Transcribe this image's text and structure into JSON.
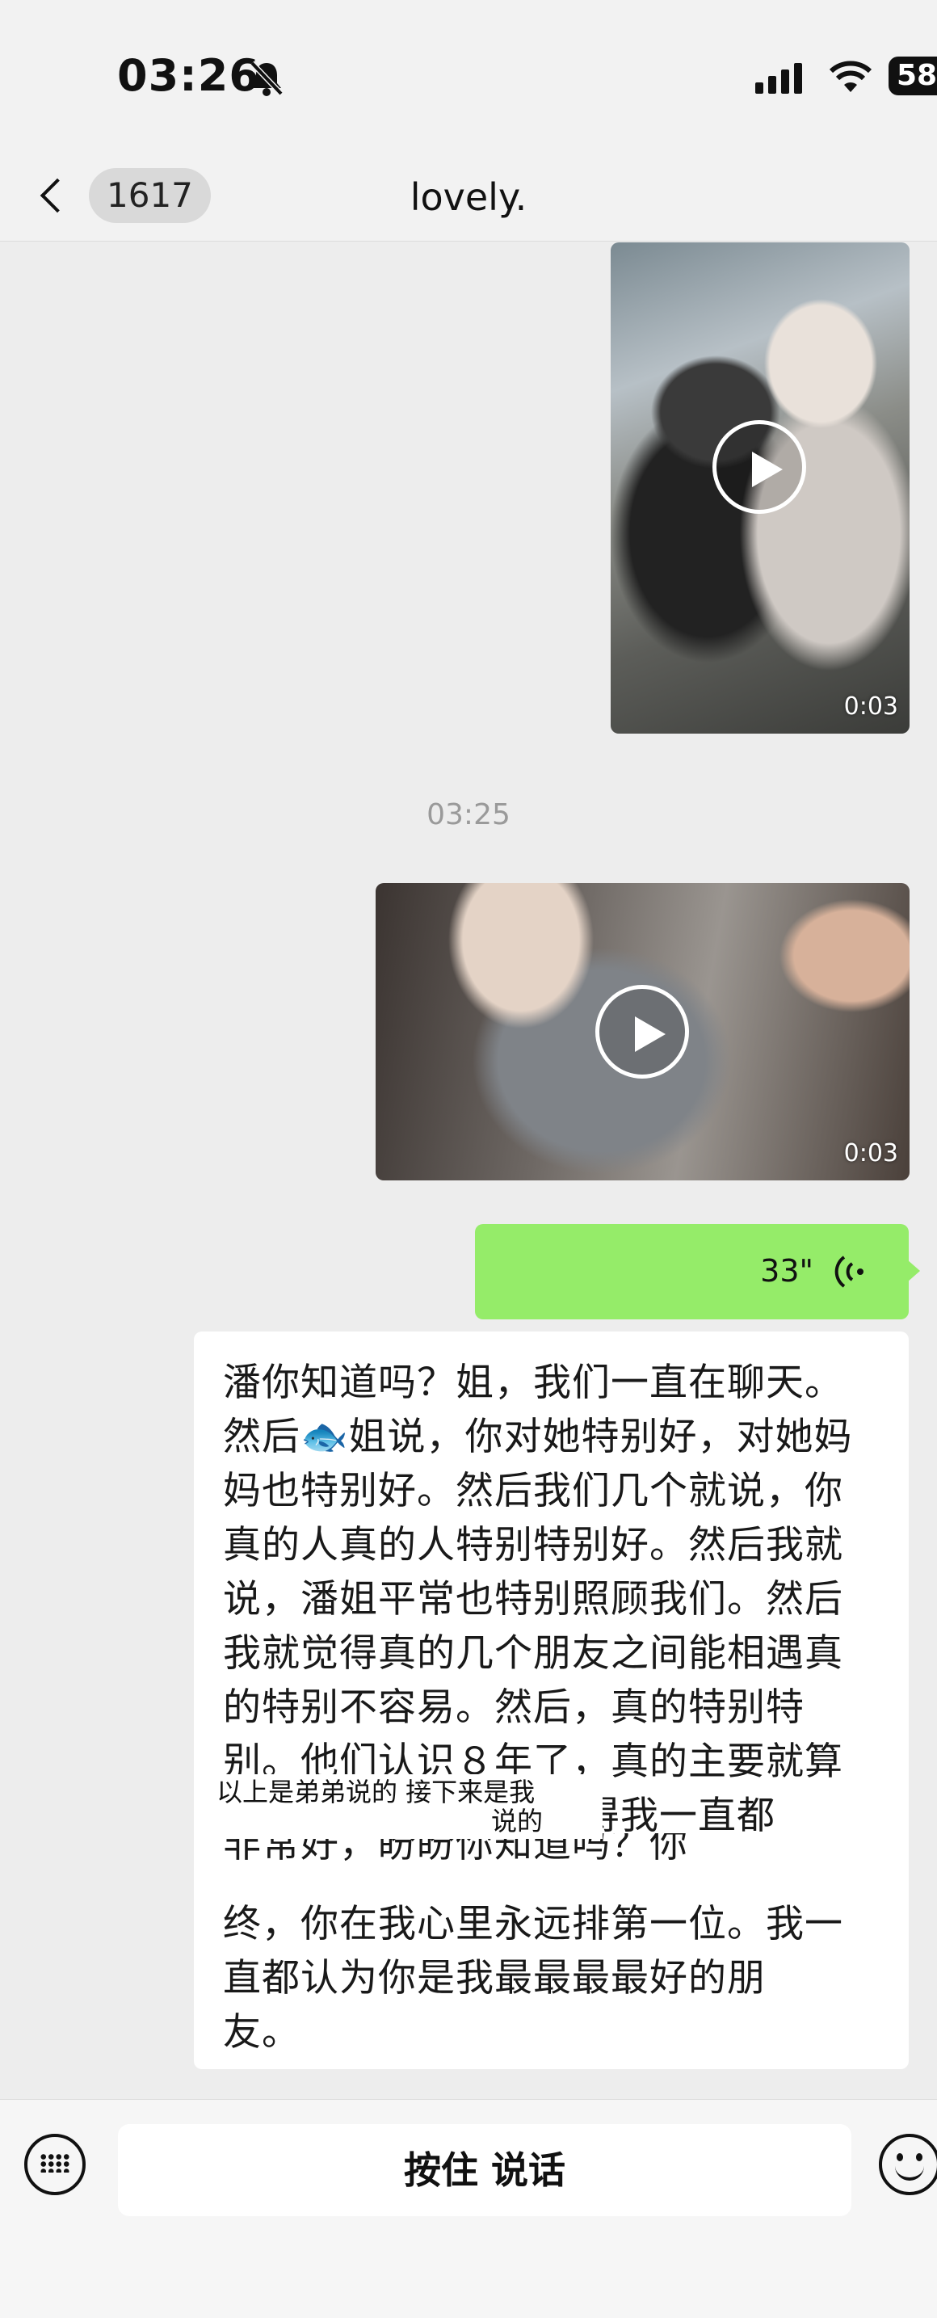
{
  "status_bar": {
    "time": "03:26",
    "battery": "58",
    "icons": [
      "bell-slash-icon",
      "signal-icon",
      "wifi-icon",
      "battery-icon"
    ]
  },
  "nav": {
    "unread_count": "1617",
    "title": "lovely."
  },
  "messages": {
    "video_1": {
      "duration": "0:03"
    },
    "timestamp": "03:25",
    "video_2": {
      "duration": "0:03"
    },
    "voice": {
      "length": "33\""
    },
    "text": {
      "lines": [
        "潘你知道吗？姐，我们一直在聊天。",
        "然后🐟姐说，你对她特别好，对她妈",
        "妈也特别好。然后我们几个就说，你",
        "真的人真的人特别特别好。然后我就",
        "说，潘姐平常也特别照顾我们。然后",
        "我就觉得真的几个朋友之间能相遇真",
        "的特别不容易。然后，真的特别特",
        "别。他们认识８年了，真的主要就算",
        "真的觉得我一直都",
        "非常好，盼盼你知道吗？你从始至",
        "终，你在我心里永远排第一位。我一",
        "直都认为你是我最最最最好的朋",
        "友。"
      ],
      "overlay_note_line1": "以上是弟弟说的 接下来是我",
      "overlay_note_line2": "说的"
    }
  },
  "input_bar": {
    "talk_label": "按住 说话"
  },
  "colors": {
    "background": "#ededed",
    "self_bubble": "#95ec69",
    "other_bubble": "#ffffff"
  }
}
